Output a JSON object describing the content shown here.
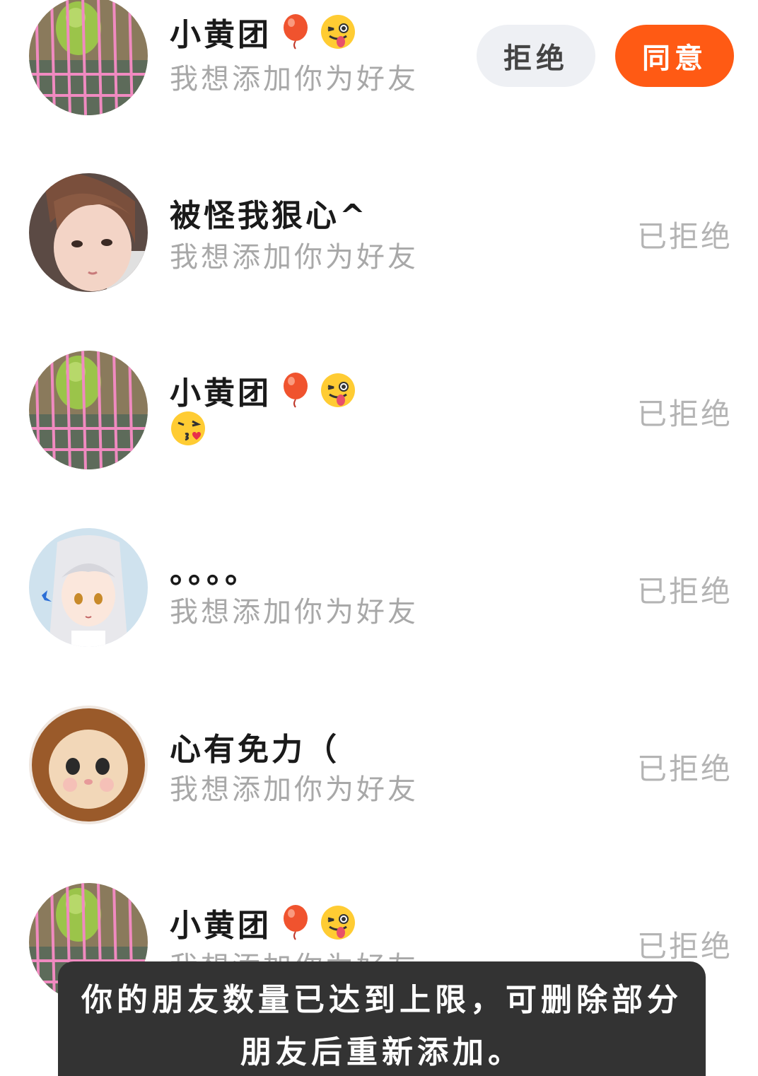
{
  "requests": [
    {
      "name": "小黄团",
      "name_emojis": [
        "balloon-emoji",
        "winking-tongue-emoji"
      ],
      "subtitle": "我想添加你为好友",
      "subtitle_emoji": null,
      "avatar": "parrot-cage-avatar",
      "state": "pending",
      "reject_label": "拒绝",
      "accept_label": "同意"
    },
    {
      "name": "被怪我狠心^",
      "name_emojis": [],
      "subtitle": "我想添加你为好友",
      "subtitle_emoji": null,
      "avatar": "girl-avatar",
      "state": "rejected",
      "status_label": "已拒绝"
    },
    {
      "name": "小黄团",
      "name_emojis": [
        "balloon-emoji",
        "winking-tongue-emoji"
      ],
      "subtitle": "",
      "subtitle_emoji": "kissing-heart-emoji",
      "avatar": "parrot-cage-avatar",
      "state": "rejected",
      "status_label": "已拒绝"
    },
    {
      "name": "。。。。",
      "name_emojis": [],
      "subtitle": "我想添加你为好友",
      "subtitle_emoji": null,
      "avatar": "anime-girl-avatar",
      "state": "rejected",
      "status_label": "已拒绝"
    },
    {
      "name": "心有免力（",
      "name_emojis": [],
      "subtitle": "我想添加你为好友",
      "subtitle_emoji": null,
      "avatar": "cat-lion-hat-avatar",
      "state": "rejected",
      "status_label": "已拒绝"
    },
    {
      "name": "小黄团",
      "name_emojis": [
        "balloon-emoji",
        "winking-tongue-emoji"
      ],
      "subtitle": "我想添加你为好友",
      "subtitle_emoji": null,
      "avatar": "parrot-cage-avatar",
      "state": "rejected",
      "status_label": "已拒绝"
    }
  ],
  "toast": {
    "line1": "你的朋友数量已达到上限，可删除部分",
    "line2": "朋友后重新添加。"
  },
  "colors": {
    "accent": "#ff5a14",
    "reject_bg": "#eef0f4",
    "toast_bg": "#333333",
    "subtitle": "#a8a8a8"
  }
}
